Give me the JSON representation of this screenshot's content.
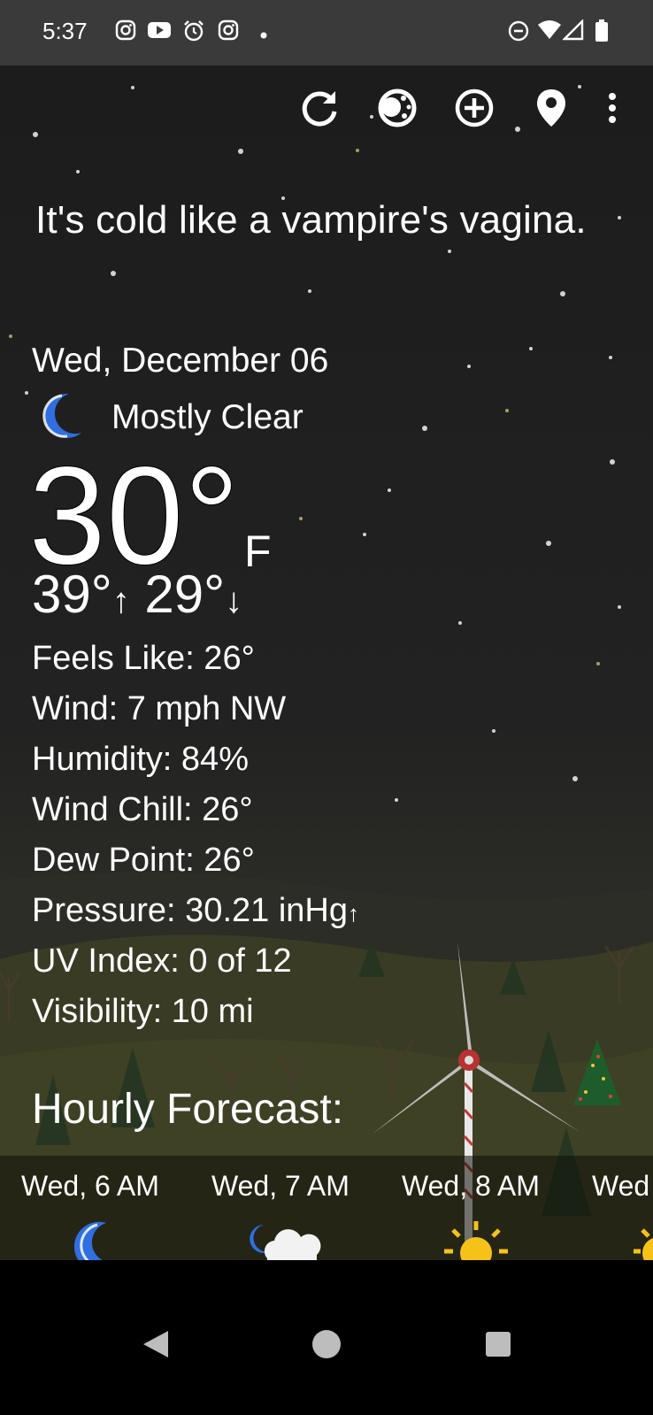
{
  "status_bar": {
    "time": "5:37",
    "left_icons": [
      "instagram-icon",
      "youtube-icon",
      "alarm-icon",
      "instagram-icon",
      "dot-icon"
    ],
    "right_icons": [
      "do-not-disturb-icon",
      "wifi-icon",
      "signal-icon",
      "battery-icon"
    ]
  },
  "toolbar": {
    "icons": [
      "refresh-icon",
      "theme-icon",
      "add-icon",
      "location-pin-icon",
      "more-vert-icon"
    ]
  },
  "quote": "It's cold like a vampire's vagina.",
  "current": {
    "date": "Wed, December 06",
    "condition": "Mostly Clear",
    "condition_icon": "crescent-moon-icon",
    "temperature": "30°",
    "unit": "F",
    "high": "39°",
    "high_arrow": "↑",
    "low": "29°",
    "low_arrow": "↓"
  },
  "details": {
    "feels_like": "Feels Like:  26°",
    "wind": "Wind:  7 mph NW",
    "humidity": "Humidity:  84%",
    "wind_chill": "Wind Chill:  26°",
    "dew_point": "Dew Point:  26°",
    "pressure": "Pressure:  30.21 inHg",
    "pressure_arrow": "↑",
    "uv_index": "UV Index:  0 of 12",
    "visibility": "Visibility:  10 mi"
  },
  "hourly": {
    "title": "Hourly Forecast:",
    "items": [
      {
        "label": "Wed, 6 AM",
        "icon": "crescent-moon-icon"
      },
      {
        "label": "Wed, 7 AM",
        "icon": "moon-cloud-icon"
      },
      {
        "label": "Wed, 8 AM",
        "icon": "sun-icon"
      },
      {
        "label": "Wed",
        "icon": "sun-icon"
      }
    ]
  },
  "colors": {
    "moon_blue": "#2f6fe0",
    "sun_yellow": "#f6c21a",
    "background": "#1c1c1c"
  },
  "nav": {
    "icons": [
      "back-icon",
      "home-icon",
      "recents-icon"
    ]
  }
}
